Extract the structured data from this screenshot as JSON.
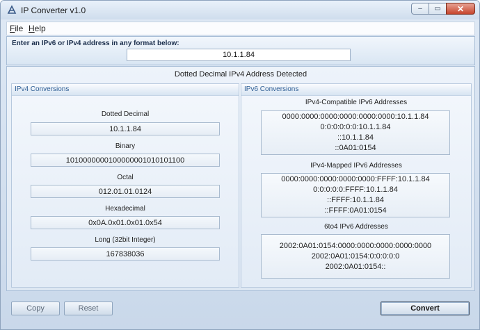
{
  "window": {
    "title": "IP Converter v1.0",
    "controls": {
      "minimize": "–",
      "maximize": "▭",
      "close": "✕"
    }
  },
  "menu": {
    "file": {
      "accel": "F",
      "rest": "ile"
    },
    "help": {
      "accel": "H",
      "rest": "elp"
    }
  },
  "input": {
    "prompt": "Enter an IPv6 or IPv4 address in any format below:",
    "value": "10.1.1.84"
  },
  "detected": "Dotted Decimal IPv4 Address Detected",
  "ipv4": {
    "title": "IPv4 Conversions",
    "fields": [
      {
        "label": "Dotted Decimal",
        "value": "10.1.1.84"
      },
      {
        "label": "Binary",
        "value": "1010000000100000001010101100"
      },
      {
        "label": "Octal",
        "value": "012.01.01.0124"
      },
      {
        "label": "Hexadecimal",
        "value": "0x0A.0x01.0x01.0x54"
      },
      {
        "label": "Long (32bit Integer)",
        "value": "167838036"
      }
    ]
  },
  "ipv6": {
    "title": "IPv6 Conversions",
    "compatible": {
      "label": "IPv4-Compatible IPv6 Addresses",
      "lines": [
        "0000:0000:0000:0000:0000:0000:10.1.1.84",
        "0:0:0:0:0:0:10.1.1.84",
        "::10.1.1.84",
        "::0A01:0154"
      ]
    },
    "mapped": {
      "label": "IPv4-Mapped IPv6 Addresses",
      "lines": [
        "0000:0000:0000:0000:0000:FFFF:10.1.1.84",
        "0:0:0:0:0:FFFF:10.1.1.84",
        "::FFFF:10.1.1.84",
        "::FFFF:0A01:0154"
      ]
    },
    "sixtofour": {
      "label": "6to4 IPv6 Addresses",
      "lines": [
        "2002:0A01:0154:0000:0000:0000:0000:0000",
        "2002:0A01:0154:0:0:0:0:0",
        "2002:0A01:0154::"
      ]
    }
  },
  "buttons": {
    "copy": "Copy",
    "reset": "Reset",
    "convert": "Convert"
  },
  "colors": {
    "accent": "#2f5e94",
    "window_bg": "#dfe9f5"
  }
}
